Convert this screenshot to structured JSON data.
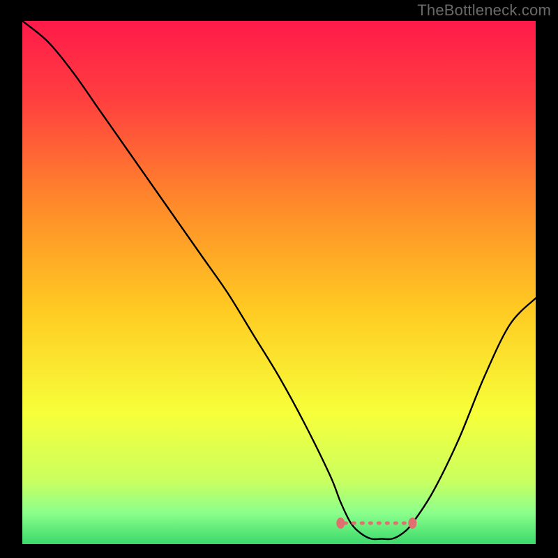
{
  "watermark": "TheBottleneck.com",
  "chart_data": {
    "type": "line",
    "title": "",
    "xlabel": "",
    "ylabel": "",
    "xlim": [
      0,
      100
    ],
    "ylim": [
      0,
      100
    ],
    "x": [
      0,
      5,
      10,
      15,
      20,
      25,
      30,
      35,
      40,
      45,
      50,
      55,
      60,
      62,
      64,
      66,
      68,
      70,
      72,
      74,
      76,
      80,
      85,
      90,
      95,
      100
    ],
    "values": [
      100,
      96,
      90,
      83,
      76,
      69,
      62,
      55,
      48,
      40,
      32,
      23,
      13,
      8,
      4,
      2,
      1,
      1,
      1,
      2,
      4,
      10,
      20,
      32,
      42,
      47
    ],
    "trough_region": {
      "x_start": 62,
      "x_end": 76,
      "y": 4
    },
    "gradient_stops": [
      {
        "offset": 0.0,
        "color": "#ff1a4a"
      },
      {
        "offset": 0.15,
        "color": "#ff3f3f"
      },
      {
        "offset": 0.35,
        "color": "#ff8a2a"
      },
      {
        "offset": 0.55,
        "color": "#ffca22"
      },
      {
        "offset": 0.75,
        "color": "#f7ff3a"
      },
      {
        "offset": 0.88,
        "color": "#c9ff60"
      },
      {
        "offset": 0.94,
        "color": "#8cff8c"
      },
      {
        "offset": 1.0,
        "color": "#3bd96b"
      }
    ]
  }
}
